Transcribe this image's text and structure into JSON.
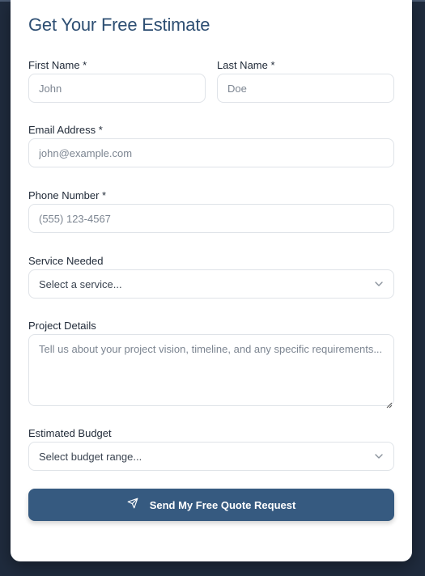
{
  "form": {
    "title": "Get Your Free Estimate",
    "first_name": {
      "label": "First Name *",
      "placeholder": "John"
    },
    "last_name": {
      "label": "Last Name *",
      "placeholder": "Doe"
    },
    "email": {
      "label": "Email Address *",
      "placeholder": "john@example.com"
    },
    "phone": {
      "label": "Phone Number *",
      "placeholder": "(555) 123-4567"
    },
    "service": {
      "label": "Service Needed",
      "selected": "Select a service..."
    },
    "details": {
      "label": "Project Details",
      "placeholder": "Tell us about your project vision, timeline, and any specific requirements..."
    },
    "budget": {
      "label": "Estimated Budget",
      "selected": "Select budget range..."
    },
    "submit_label": "Send My Free Quote Request"
  },
  "icons": {
    "submit": "send-icon",
    "dropdown": "chevron-down-icon"
  },
  "colors": {
    "page_background": "#1f2b3d",
    "title": "#2e4f73",
    "button": "#365a80"
  }
}
